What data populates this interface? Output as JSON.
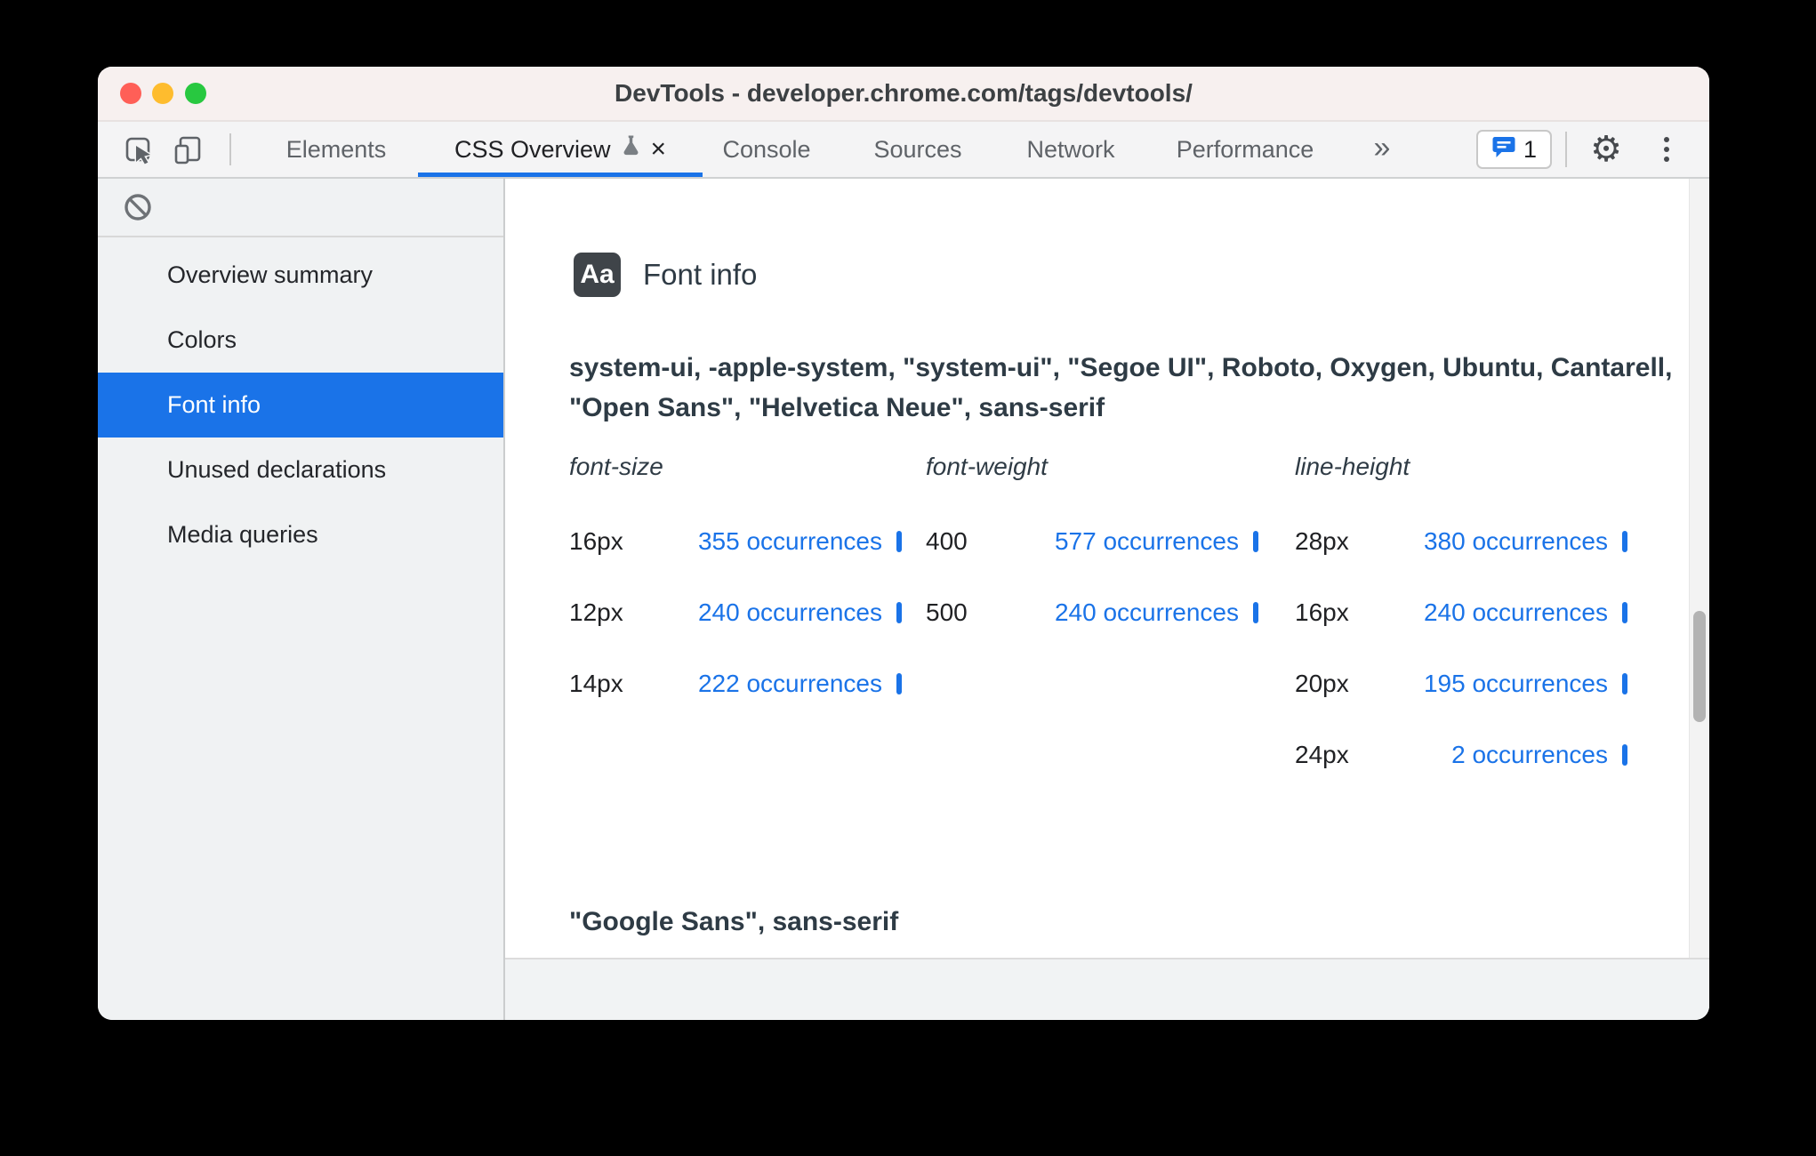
{
  "window": {
    "title": "DevTools - developer.chrome.com/tags/devtools/"
  },
  "toolbar": {
    "tabs": [
      {
        "label": "Elements",
        "active": false
      },
      {
        "label": "CSS Overview",
        "active": true
      },
      {
        "label": "Console",
        "active": false
      },
      {
        "label": "Sources",
        "active": false
      },
      {
        "label": "Network",
        "active": false
      },
      {
        "label": "Performance",
        "active": false
      }
    ],
    "more_tabs": "»",
    "close_tab": "×",
    "issues_badge": {
      "count": "1"
    }
  },
  "sidebar": {
    "items": [
      {
        "label": "Overview summary",
        "selected": false
      },
      {
        "label": "Colors",
        "selected": false
      },
      {
        "label": "Font info",
        "selected": true
      },
      {
        "label": "Unused declarations",
        "selected": false
      },
      {
        "label": "Media queries",
        "selected": false
      }
    ]
  },
  "main": {
    "section_icon_label": "Aa",
    "section_title": "Font info",
    "font_family": "system-ui, -apple-system, \"system-ui\", \"Segoe UI\", Roboto, Oxygen, Ubuntu, Cantarell, \"Open Sans\", \"Helvetica Neue\", sans-serif",
    "columns": [
      {
        "header": "font-size",
        "rows": [
          {
            "value": "16px",
            "occurrences": "355 occurrences"
          },
          {
            "value": "12px",
            "occurrences": "240 occurrences"
          },
          {
            "value": "14px",
            "occurrences": "222 occurrences"
          }
        ]
      },
      {
        "header": "font-weight",
        "rows": [
          {
            "value": "400",
            "occurrences": "577 occurrences"
          },
          {
            "value": "500",
            "occurrences": "240 occurrences"
          }
        ]
      },
      {
        "header": "line-height",
        "rows": [
          {
            "value": "28px",
            "occurrences": "380 occurrences"
          },
          {
            "value": "16px",
            "occurrences": "240 occurrences"
          },
          {
            "value": "20px",
            "occurrences": "195 occurrences"
          },
          {
            "value": "24px",
            "occurrences": "2 occurrences"
          }
        ]
      }
    ],
    "next_section_font_family": "\"Google Sans\", sans-serif"
  },
  "colors": {
    "accent_blue": "#1a73e8",
    "link_blue": "#1a73e8",
    "selected_item_bg": "#1a73e8",
    "traffic_red": "#ff5f57",
    "traffic_yellow": "#febc2e",
    "traffic_green": "#28c840"
  }
}
